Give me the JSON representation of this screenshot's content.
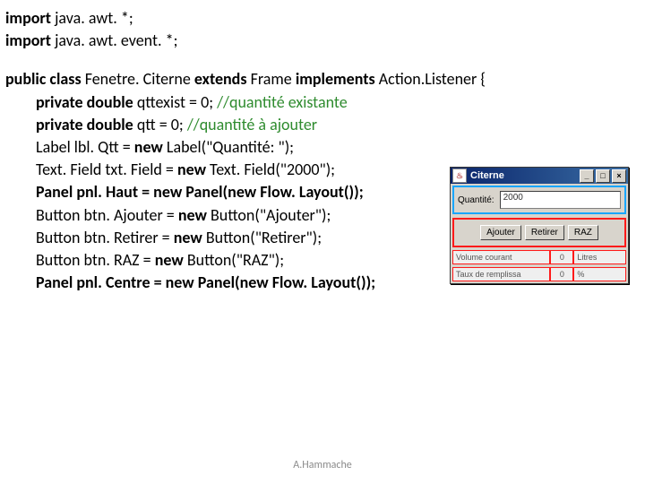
{
  "code": {
    "l1a": "import",
    "l1b": " java. awt. *;",
    "l2a": "import",
    "l2b": " java. awt. event. *;",
    "l3a": "public class",
    "l3b": " Fenetre. Citerne ",
    "l3c": "extends",
    "l3d": " Frame ",
    "l3e": "implements",
    "l3f": " Action.Listener {",
    "l4a": "private double",
    "l4b": " qttexist = 0; ",
    "l4c": "//quantité  existante",
    "l5a": "private double",
    "l5b": " qtt = 0; ",
    "l5c": "//quantité  à ajouter",
    "l6a": "Label lbl. Qtt = ",
    "l6b": "new",
    "l6c": " Label(\"Quantité: \");",
    "l7a": "Text. Field txt. Field = ",
    "l7b": "new",
    "l7c": " Text. Field(\"2000\");",
    "l8a": "Panel pnl. Haut = new Panel(new Flow. Layout());",
    "l9a": "Button btn. Ajouter = ",
    "l9b": "new",
    "l9c": " Button(\"Ajouter\");",
    "l10a": "Button btn. Retirer = ",
    "l10b": "new",
    "l10c": " Button(\"Retirer\");",
    "l11a": "Button btn. RAZ = ",
    "l11b": "new",
    "l11c": " Button(\"RAZ\");",
    "l12a": "Panel pnl. Centre = new Panel(new Flow. Layout());"
  },
  "win": {
    "title": "Citerne",
    "min": "_",
    "max": "□",
    "close": "×",
    "qtt_label": "Quantité:",
    "qtt_value": "2000",
    "btn_ajouter": "Ajouter",
    "btn_retirer": "Retirer",
    "btn_raz": "RAZ",
    "row1_label": "Volume courant",
    "row1_val": "0",
    "row1_unit": "Litres",
    "row2_label": "Taux de remplissa",
    "row2_val": "0",
    "row2_unit": "%"
  },
  "footer": "A.Hammache"
}
